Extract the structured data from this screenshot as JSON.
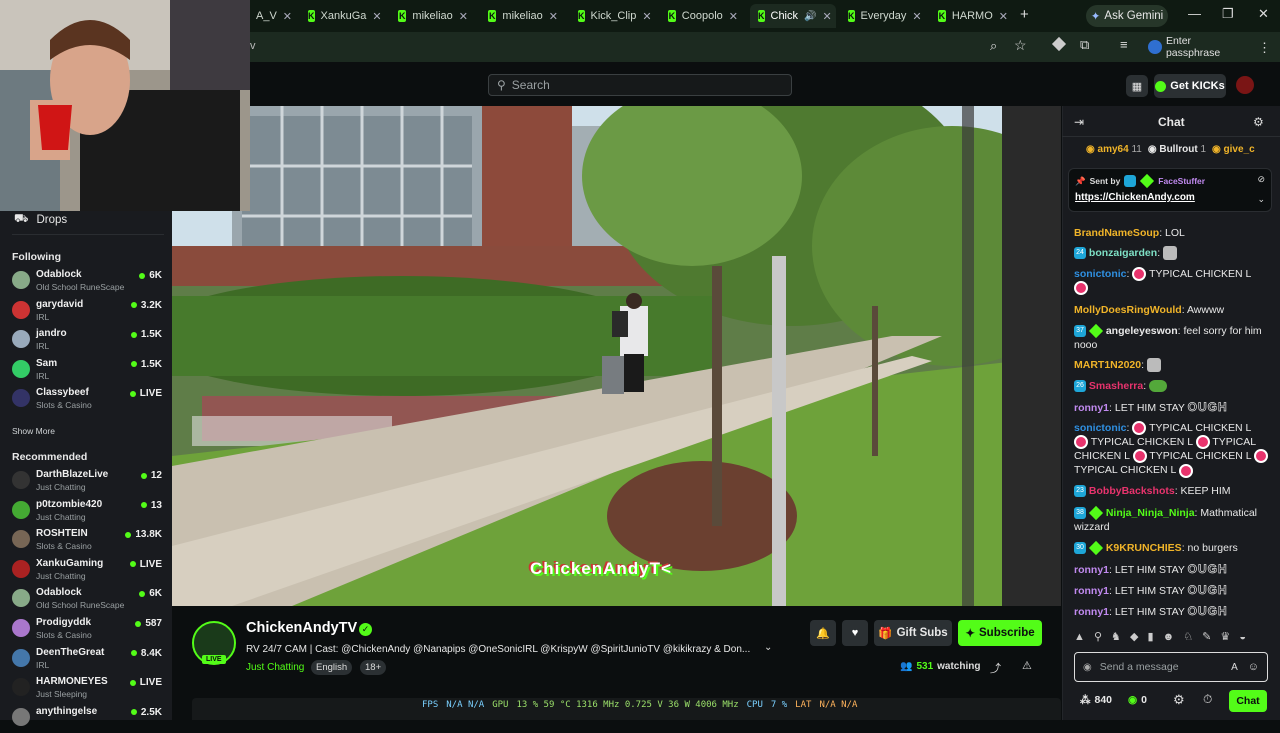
{
  "browser": {
    "tabs": [
      {
        "label": "A_V",
        "active": false
      },
      {
        "label": "XankuGa",
        "active": false
      },
      {
        "label": "mikeliao",
        "active": false
      },
      {
        "label": "mikeliao",
        "active": false
      },
      {
        "label": "Kick_Clip",
        "active": false
      },
      {
        "label": "Coopolo",
        "active": false
      },
      {
        "label": "Chick",
        "active": true
      },
      {
        "label": "Everyday",
        "active": false
      },
      {
        "label": "HARMO",
        "active": false
      }
    ],
    "ask_gemini": "Ask Gemini",
    "address_fragment": "v",
    "passphrase": "Enter passphrase"
  },
  "kick": {
    "search_placeholder": "Search",
    "get_kicks": "Get KICKs"
  },
  "sidebar": {
    "drops": "Drops",
    "following_header": "Following",
    "following": [
      {
        "name": "Odablock",
        "category": "Old School RuneScape",
        "viewers": "6K",
        "color": "#8a8"
      },
      {
        "name": "garydavid",
        "category": "IRL",
        "viewers": "3.2K",
        "color": "#c33"
      },
      {
        "name": "jandro",
        "category": "IRL",
        "viewers": "1.5K",
        "color": "#9ab"
      },
      {
        "name": "Sam",
        "category": "IRL",
        "viewers": "1.5K",
        "color": "#3c6"
      },
      {
        "name": "Classybeef",
        "category": "Slots & Casino",
        "viewers": "LIVE",
        "color": "#336"
      }
    ],
    "show_more": "Show More",
    "recommended_header": "Recommended",
    "recommended": [
      {
        "name": "DarthBlazeLive",
        "category": "Just Chatting",
        "viewers": "12",
        "color": "#333"
      },
      {
        "name": "p0tzombie420",
        "category": "Just Chatting",
        "viewers": "13",
        "color": "#4a3"
      },
      {
        "name": "ROSHTEIN",
        "category": "Slots & Casino",
        "viewers": "13.8K",
        "color": "#765"
      },
      {
        "name": "XankuGaming",
        "category": "Just Chatting",
        "viewers": "LIVE",
        "color": "#a22"
      },
      {
        "name": "Odablock",
        "category": "Old School RuneScape",
        "viewers": "6K",
        "color": "#8a8"
      },
      {
        "name": "Prodigyddk",
        "category": "Slots & Casino",
        "viewers": "587",
        "color": "#a7c"
      },
      {
        "name": "DeenTheGreat",
        "category": "IRL",
        "viewers": "8.4K",
        "color": "#47a"
      },
      {
        "name": "HARMONEYES",
        "category": "Just Sleeping",
        "viewers": "LIVE",
        "color": "#222"
      },
      {
        "name": "anythingelse",
        "category": "",
        "viewers": "2.5K",
        "color": "#777"
      }
    ]
  },
  "video": {
    "watermark": "ChickenAndyT<"
  },
  "stream": {
    "channel": "ChickenAndyTV",
    "live_badge": "LIVE",
    "title": "RV 24/7 CAM | Cast: @ChickenAndy @Nanapips @OneSonicIRL @KrispyW @SpiritJunioTV @kikikrazy & Don...",
    "category": "Just Chatting",
    "tags": [
      "English",
      "18+"
    ],
    "gift_subs": "Gift Subs",
    "subscribe": "Subscribe",
    "watching_count": "531",
    "watching_label": "watching"
  },
  "stats": {
    "fps": "FPS",
    "fps_vals": "N/A  N/A",
    "gpu": "GPU",
    "gpu_vals": "13 %  59 °C  1316 MHz  0.725 V  36 W  4006 MHz",
    "cpu": "CPU",
    "cpu_vals": "7 %",
    "lat": "LAT",
    "lat_vals": "N/A  N/A"
  },
  "chat": {
    "title": "Chat",
    "leaderboard": [
      {
        "name": "amy64",
        "value": "11",
        "color": "#f0b429"
      },
      {
        "name": "Bullrout",
        "value": "1",
        "color": "#e8e8e8"
      },
      {
        "name": "give_c",
        "value": "",
        "color": "#f0b429"
      }
    ],
    "pinned_sent_by": "Sent by",
    "pinned_user": "FaceStuffer",
    "pinned_link": "https://ChickenAndy.com",
    "messages": [
      {
        "user": "BrandNameSoup",
        "color": "#f0b429",
        "text": "LOL"
      },
      {
        "user": "bonzaigarden",
        "color": "#7ee0c5",
        "text": ""
      },
      {
        "user": "sonictonic",
        "color": "#2f8fe0",
        "text": "TYPICAL CHICKEN L"
      },
      {
        "user": "MollyDoesRingWould",
        "color": "#f0b429",
        "text": "Awwww"
      },
      {
        "user": "angeleyeswon",
        "color": "#e8e8e8",
        "text": "feel sorry for him nooo"
      },
      {
        "user": "MART1N2020",
        "color": "#f0b429",
        "text": ""
      },
      {
        "user": "Smasherra",
        "color": "#e8336d",
        "text": ""
      },
      {
        "user": "ronny1",
        "color": "#c18af0",
        "text": "LET HIM STAY"
      },
      {
        "user": "sonictonic",
        "color": "#2f8fe0",
        "text": "TYPICAL CHICKEN L"
      },
      {
        "user": "TYPICAL CHICKEN L",
        "color": "#e8e8e8",
        "text": "TYPICAL CHICKEN L"
      },
      {
        "user": "BobbyBackshots",
        "color": "#e8336d",
        "text": "KEEP HIM"
      },
      {
        "user": "Ninja_Ninja_Ninja",
        "color": "#53fc18",
        "text": "Mathmatical wizzard"
      },
      {
        "user": "K9KRUNCHIES",
        "color": "#f0b429",
        "text": "no burgers"
      },
      {
        "user": "ronny1",
        "color": "#c18af0",
        "text": "LET HIM STAY"
      },
      {
        "user": "ronny1",
        "color": "#c18af0",
        "text": "LET HIM STAY"
      },
      {
        "user": "ronny1",
        "color": "#c18af0",
        "text": "LET HIM STAY"
      }
    ],
    "ough": "OUGH",
    "typical_l": "TYPICAL CHICKEN L",
    "input_placeholder": "Send a message",
    "points": "840",
    "kicks": "0",
    "send": "Chat"
  }
}
